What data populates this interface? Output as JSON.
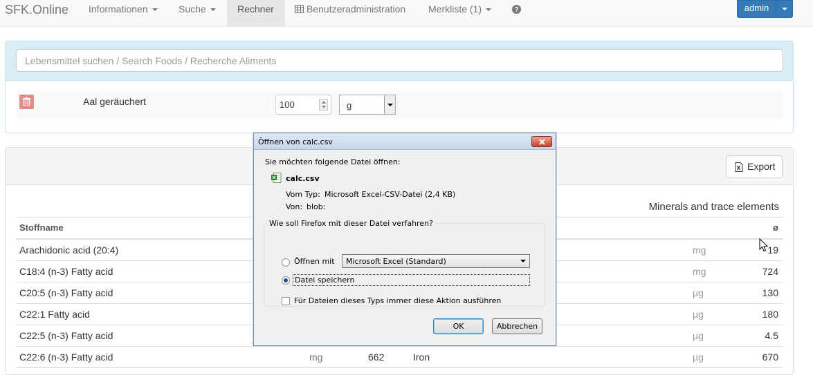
{
  "navbar": {
    "brand": "SFK.Online",
    "items": [
      {
        "label": "Informationen",
        "dropdown": true
      },
      {
        "label": "Suche",
        "dropdown": true
      },
      {
        "label": "Rechner",
        "active": true
      },
      {
        "label": "Benutzeradministration",
        "icon": "table-icon"
      },
      {
        "label": "Merkliste (1)",
        "dropdown": true
      },
      {
        "label": "",
        "icon": "help-icon"
      }
    ],
    "user_button": "admin"
  },
  "search": {
    "placeholder": "Lebensmittel suchen / Search Foods / Recherche Aliments"
  },
  "selection": {
    "food": "Aal geräuchert",
    "quantity": "100",
    "unit": "g"
  },
  "results": {
    "export_label": "Export",
    "section_title": "Minerals and trace elements",
    "col_name": "Stoffname",
    "col_avg": "ø",
    "rows": [
      {
        "name": "Arachidonic acid (20:4)",
        "unit1": "",
        "value1": "",
        "name2": "",
        "unit2": "mg",
        "value2": "19"
      },
      {
        "name": "C18:4 (n-3) Fatty acid",
        "unit1": "",
        "value1": "",
        "name2": "",
        "unit2": "mg",
        "value2": "724"
      },
      {
        "name": "C20:5 (n-3) Fatty acid",
        "unit1": "",
        "value1": "",
        "name2": "",
        "unit2": "µg",
        "value2": "130"
      },
      {
        "name": "C22:1 Fatty acid",
        "unit1": "",
        "value1": "",
        "name2": "",
        "unit2": "µg",
        "value2": "180"
      },
      {
        "name": "C22:5 (n-3) Fatty acid",
        "unit1": "",
        "value1": "",
        "name2": "",
        "unit2": "µg",
        "value2": "4.5"
      },
      {
        "name": "C22:6 (n-3) Fatty acid",
        "unit1": "mg",
        "value1": "662",
        "name2": "Iron",
        "unit2": "µg",
        "value2": "670"
      }
    ]
  },
  "dialog": {
    "title": "Öffnen von calc.csv",
    "ask": "Sie möchten folgende Datei öffnen:",
    "filename": "calc.csv",
    "type_label": "Vom Typ:",
    "type_value": "Microsoft Excel-CSV-Datei (2,4 KB)",
    "from_label": "Von:",
    "from_value": "blob:",
    "group_label": "Wie soll Firefox mit dieser Datei verfahren?",
    "open_with_label": "Öffnen mit",
    "open_with_app": "Microsoft Excel (Standard)",
    "save_label": "Datei speichern",
    "save_selected": true,
    "always_label": "Für Dateien dieses Typs immer diese Aktion ausführen",
    "ok": "OK",
    "cancel": "Abbrechen"
  },
  "colors": {
    "primary": "#337ab7",
    "danger": "#e38d8a",
    "info_bg": "#d9edf7"
  }
}
